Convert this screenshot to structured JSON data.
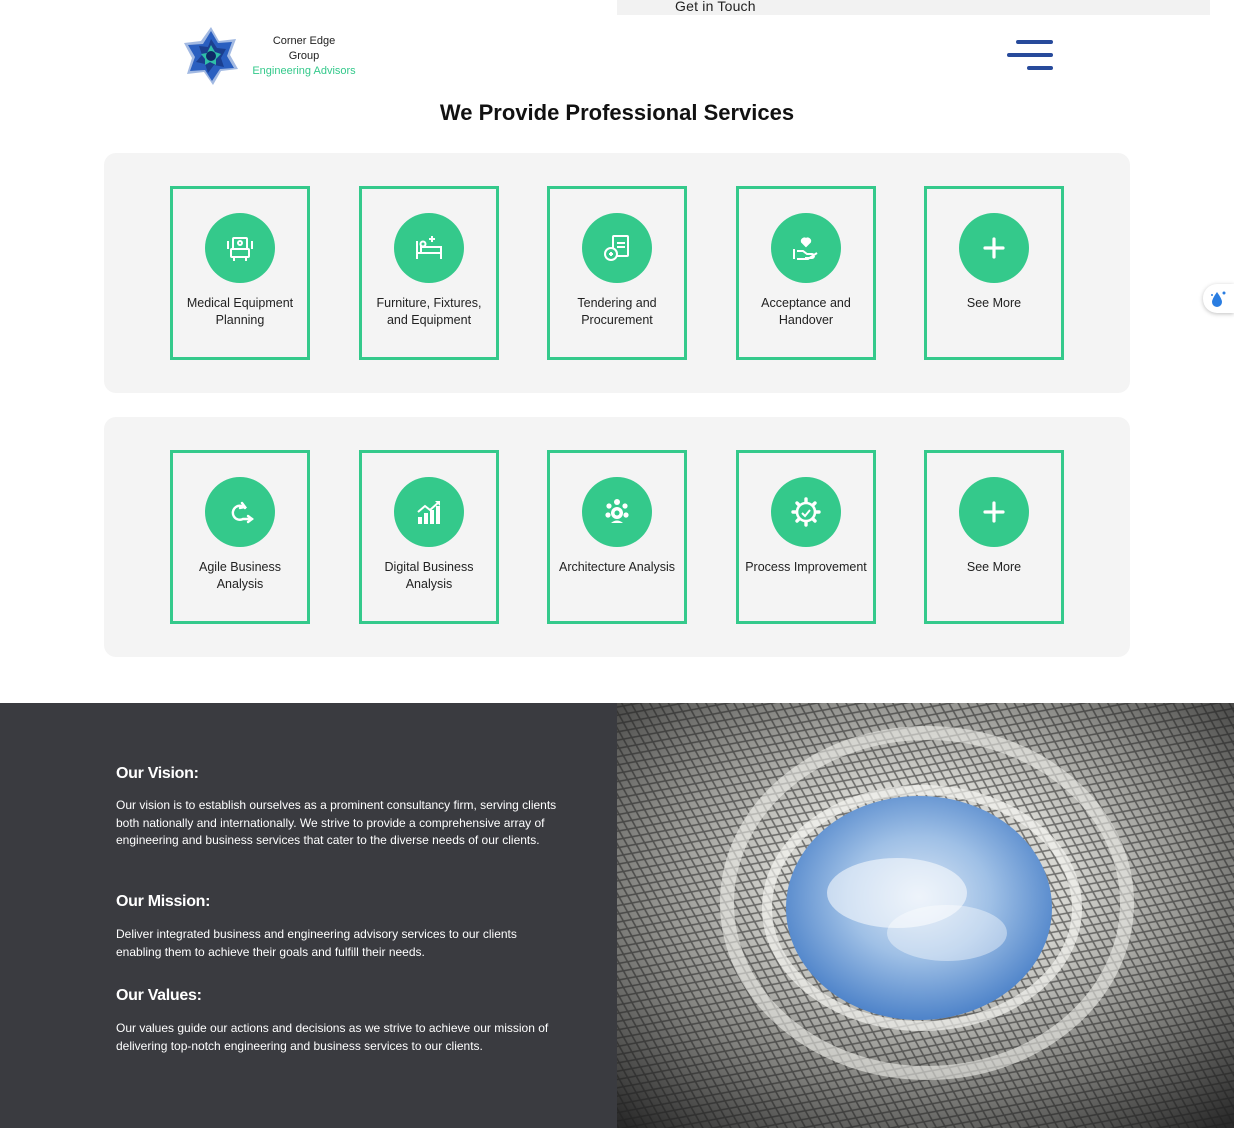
{
  "topbar": {
    "cta_label": "Get in Touch"
  },
  "logo": {
    "line1": "Corner Edge",
    "line2": "Group",
    "tagline": "Engineering Advisors"
  },
  "services": {
    "title": "We Provide Professional Services",
    "row1": [
      {
        "label": "Medical Equipment Planning",
        "icon": "medical-equipment-icon"
      },
      {
        "label": "Furniture, Fixtures, and Equipment",
        "icon": "hospital-bed-icon"
      },
      {
        "label": "Tendering and Procurement",
        "icon": "document-icon"
      },
      {
        "label": "Acceptance and Handover",
        "icon": "hand-heart-icon"
      },
      {
        "label": "See More",
        "icon": "plus-icon"
      }
    ],
    "row2": [
      {
        "label": "Agile Business Analysis",
        "icon": "agile-cycle-icon"
      },
      {
        "label": "Digital Business Analysis",
        "icon": "growth-chart-icon"
      },
      {
        "label": "Architecture Analysis",
        "icon": "team-gear-icon"
      },
      {
        "label": "Process Improvement",
        "icon": "process-gear-icon"
      },
      {
        "label": "See More",
        "icon": "plus-icon"
      }
    ]
  },
  "about": {
    "vision_title": "Our Vision:",
    "vision_text": "Our vision is to establish ourselves as a prominent consultancy firm, serving clients both nationally and internationally. We strive to provide a comprehensive array of engineering and business services that cater to the diverse needs of our clients.",
    "mission_title": "Our Mission:",
    "mission_text": "Deliver integrated business and engineering advisory services to our clients enabling them to achieve their goals and fulfill their needs.",
    "values_title": "Our Values:",
    "values_text": "Our values guide our actions and decisions as we strive to achieve our mission of delivering top-notch engineering and business services to our clients."
  },
  "colors": {
    "accent": "#34c98b",
    "dark_panel": "#3a3b40",
    "menu": "#274a9b",
    "panel_bg": "#f4f4f4"
  }
}
